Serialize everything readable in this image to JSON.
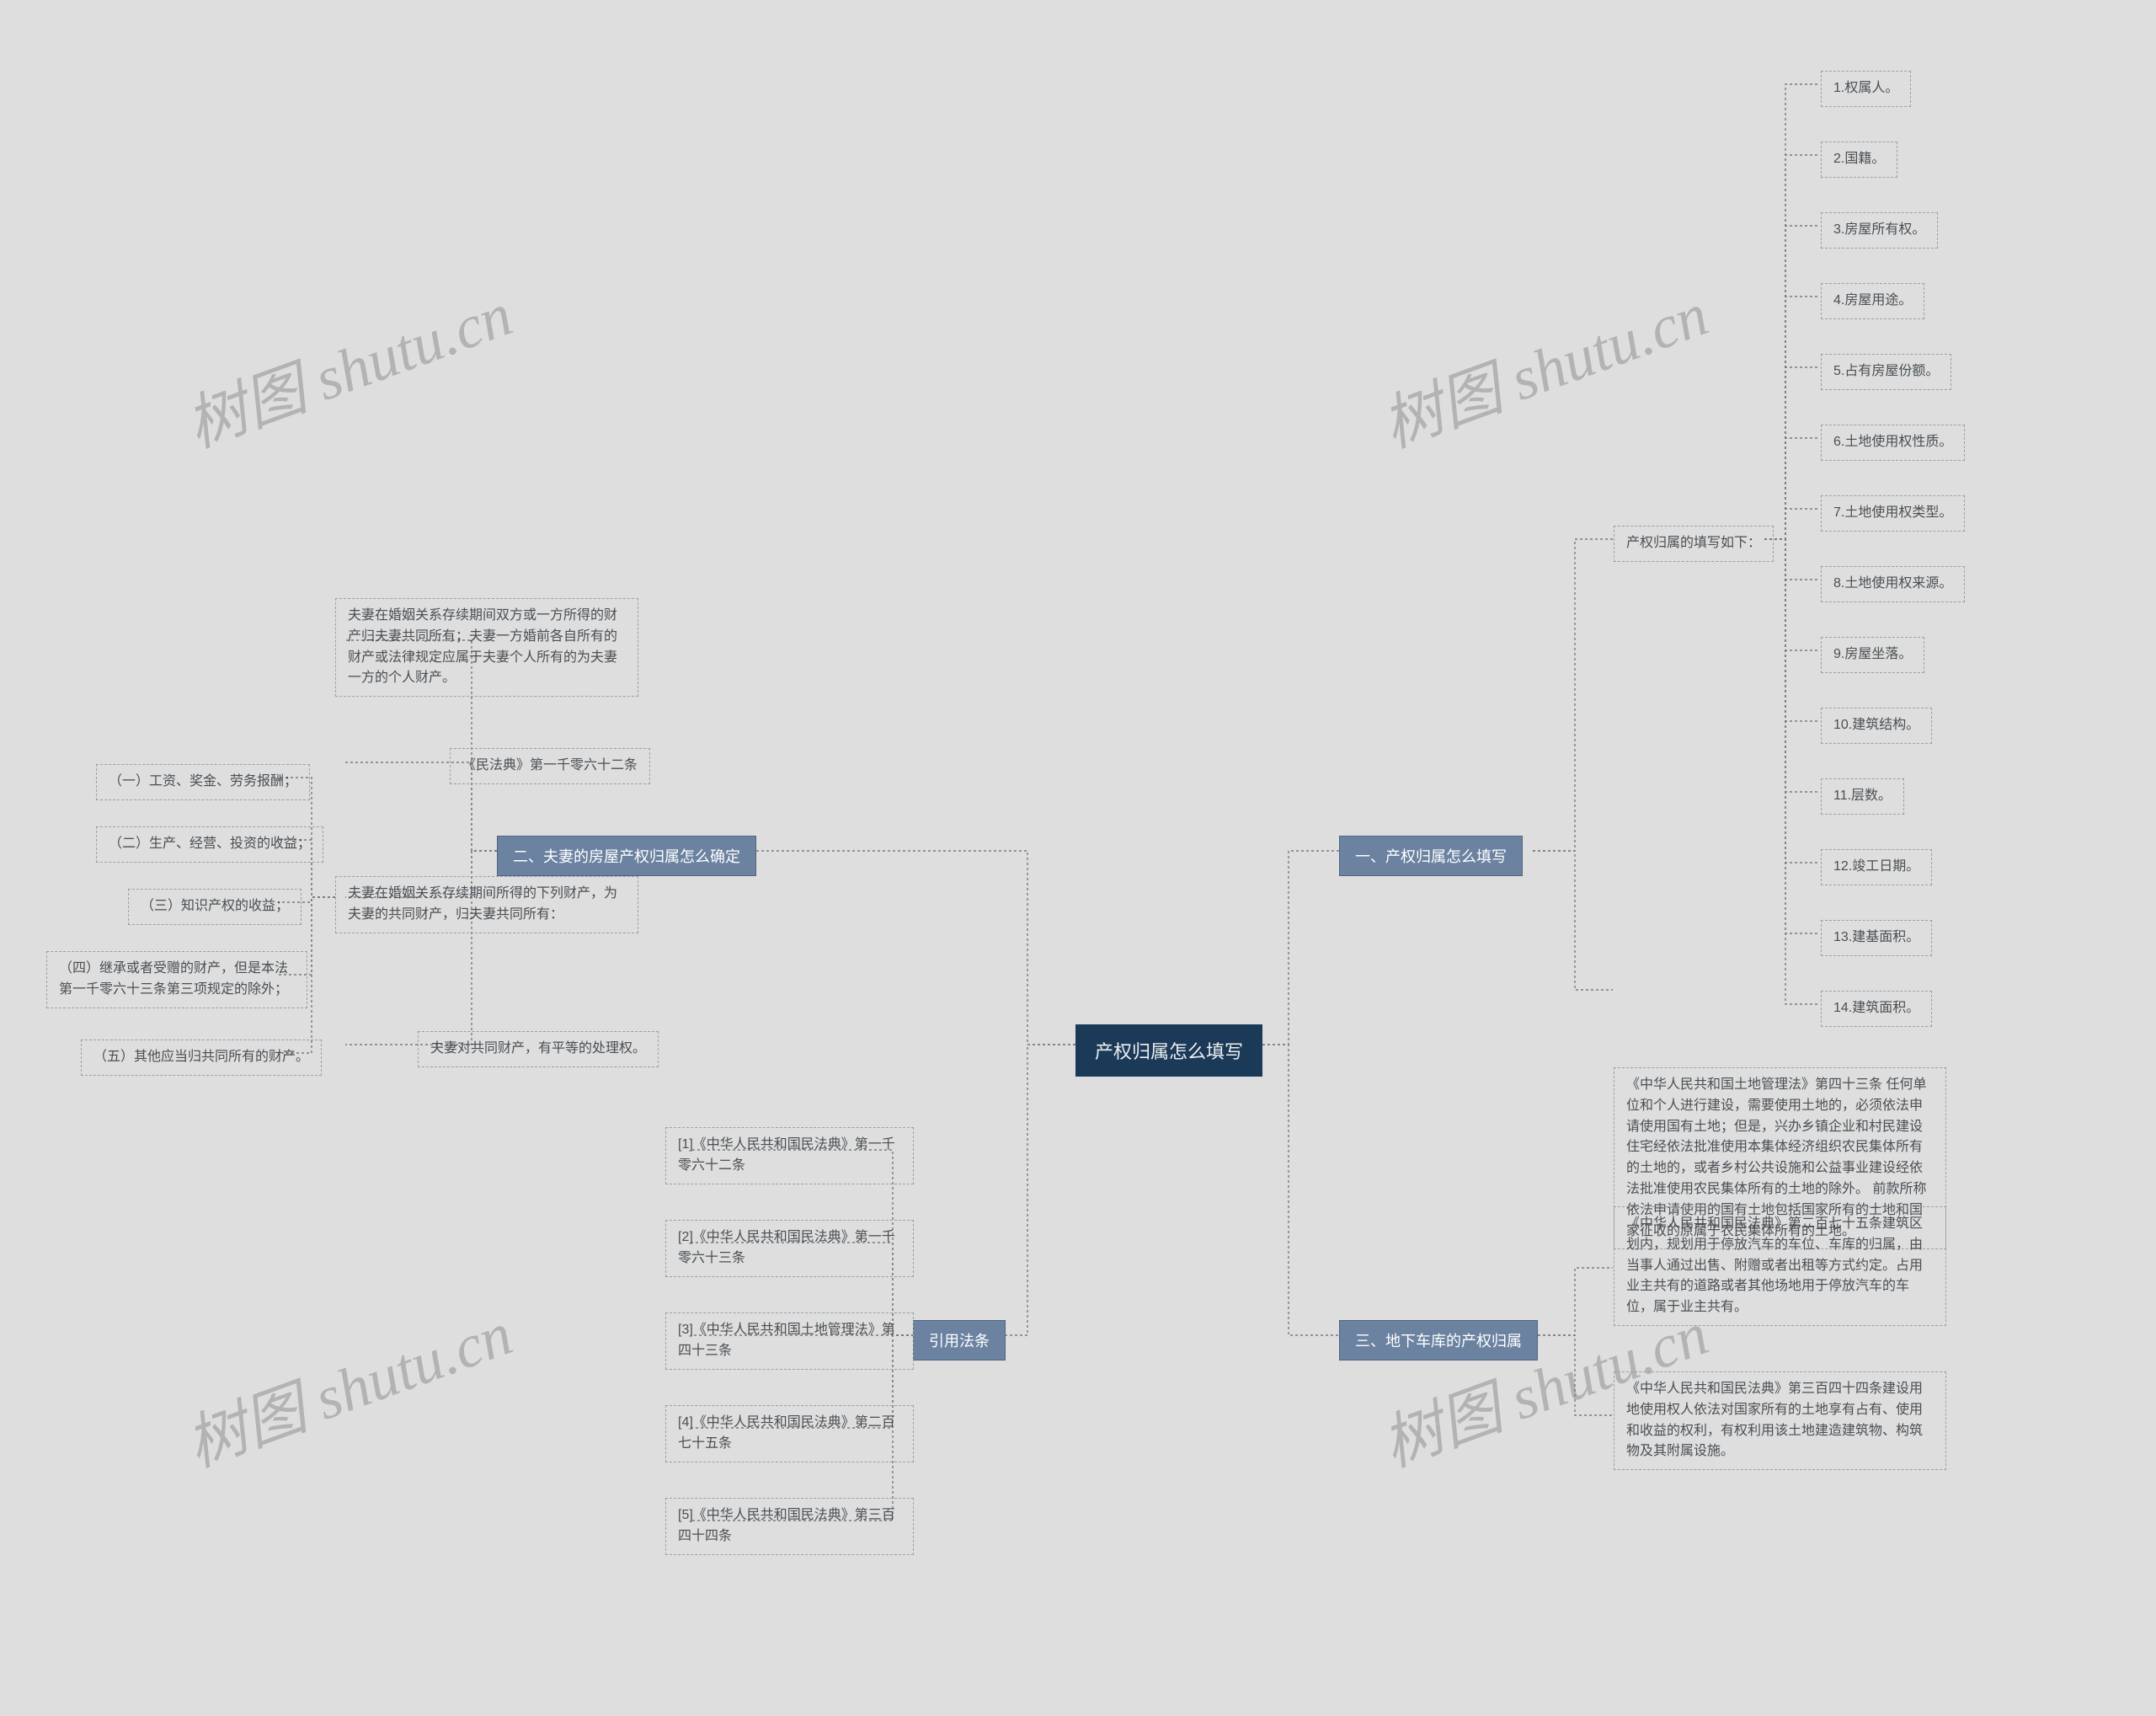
{
  "watermark": "树图 shutu.cn",
  "root": "产权归属怎么填写",
  "b1": {
    "title": "一、产权归属怎么填写"
  },
  "b2": {
    "title": "二、夫妻的房屋产权归属怎么确定"
  },
  "b3": {
    "title": "三、地下车库的产权归属"
  },
  "b4": {
    "title": "引用法条"
  },
  "s1": {
    "heading": "产权归属的填写如下：",
    "items": [
      "1.权属人。",
      "2.国籍。",
      "3.房屋所有权。",
      "4.房屋用途。",
      "5.占有房屋份额。",
      "6.土地使用权性质。",
      "7.土地使用权类型。",
      "8.土地使用权来源。",
      "9.房屋坐落。",
      "10.建筑结构。",
      "11.层数。",
      "12.竣工日期。",
      "13.建基面积。",
      "14.建筑面积。"
    ],
    "law43": "《中华人民共和国土地管理法》第四十三条 任何单位和个人进行建设，需要使用土地的，必须依法申请使用国有土地；但是，兴办乡镇企业和村民建设住宅经依法批准使用本集体经济组织农民集体所有的土地的，或者乡村公共设施和公益事业建设经依法批准使用农民集体所有的土地的除外。 前款所称依法申请使用的国有土地包括国家所有的土地和国家征收的原属于农民集体所有的土地。"
  },
  "s2": {
    "p1": "夫妻在婚姻关系存续期间双方或一方所得的财产归夫妻共同所有；夫妻一方婚前各自所有的财产或法律规定应属于夫妻个人所有的为夫妻一方的个人财产。",
    "p2": "《民法典》第一千零六十二条",
    "p3": "夫妻在婚姻关系存续期间所得的下列财产，为夫妻的共同财产，归夫妻共同所有：",
    "items": [
      "（一）工资、奖金、劳务报酬；",
      "（二）生产、经营、投资的收益；",
      "（三）知识产权的收益；",
      "（四）继承或者受赠的财产，但是本法第一千零六十三条第三项规定的除外；",
      "（五）其他应当归共同所有的财产。"
    ],
    "p4": "夫妻对共同财产，有平等的处理权。"
  },
  "s3": {
    "p1": "《中华人民共和国民法典》第二百七十五条建筑区划内，规划用于停放汽车的车位、车库的归属，由当事人通过出售、附赠或者出租等方式约定。占用业主共有的道路或者其他场地用于停放汽车的车位，属于业主共有。",
    "p2": "《中华人民共和国民法典》第三百四十四条建设用地使用权人依法对国家所有的土地享有占有、使用和收益的权利，有权利用该土地建造建筑物、构筑物及其附属设施。"
  },
  "s4": {
    "items": [
      "[1]《中华人民共和国民法典》第一千零六十二条",
      "[2]《中华人民共和国民法典》第一千零六十三条",
      "[3]《中华人民共和国土地管理法》第四十三条",
      "[4]《中华人民共和国民法典》第二百七十五条",
      "[5]《中华人民共和国民法典》第三百四十四条"
    ]
  }
}
